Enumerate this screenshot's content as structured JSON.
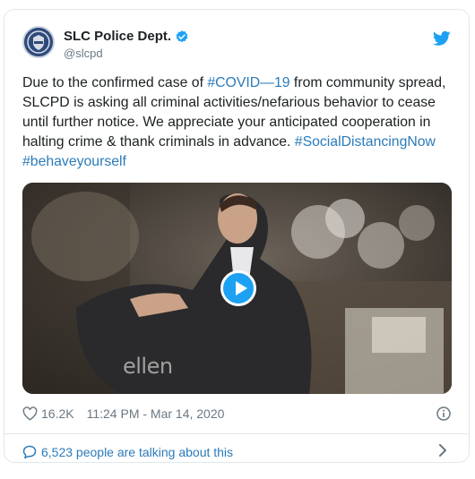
{
  "author": {
    "display_name": "SLC Police Dept.",
    "handle": "@slcpd",
    "verified": true,
    "avatar_icon": "police-badge-icon"
  },
  "tweet": {
    "text_part1": "Due to the confirmed case of ",
    "hashtag1": "#COVID—19",
    "text_part2": " from community spread, SLCPD is asking all criminal activities/nefarious behavior to cease until further notice. We appreciate your anticipated cooperation in halting crime & thank criminals in advance. ",
    "hashtag2": "#SocialDistancingNow",
    "hashtag3": "#behaveyourself"
  },
  "media": {
    "type": "gif-video",
    "watermark": "ellen"
  },
  "meta": {
    "likes": "16.2K",
    "timestamp": "11:24 PM - Mar 14, 2020"
  },
  "conversation": {
    "label": "6,523 people are talking about this"
  },
  "colors": {
    "link": "#2b7bb9",
    "twitter_blue": "#1da1f2",
    "muted": "#697882",
    "border": "#e1e8ed"
  }
}
